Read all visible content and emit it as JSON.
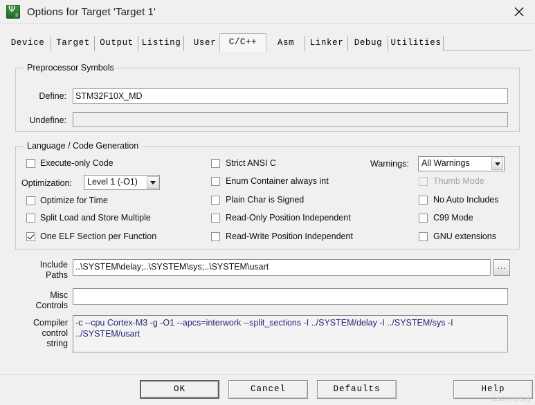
{
  "window": {
    "title": "Options for Target 'Target 1'",
    "icon": "keil-uvision-icon",
    "close_label": "✕"
  },
  "tabs": [
    {
      "label": "Device",
      "active": false
    },
    {
      "label": "Target",
      "active": false
    },
    {
      "label": "Output",
      "active": false
    },
    {
      "label": "Listing",
      "active": false
    },
    {
      "label": "User",
      "active": false
    },
    {
      "label": "C/C++",
      "active": true
    },
    {
      "label": "Asm",
      "active": false
    },
    {
      "label": "Linker",
      "active": false
    },
    {
      "label": "Debug",
      "active": false
    },
    {
      "label": "Utilities",
      "active": false
    }
  ],
  "preprocessor": {
    "legend": "Preprocessor Symbols",
    "define_label": "Define:",
    "define_value": "STM32F10X_MD",
    "undefine_label": "Undefine:",
    "undefine_value": ""
  },
  "language": {
    "legend": "Language / Code Generation",
    "col1": [
      {
        "name": "execute-only-code",
        "label": "Execute-only Code",
        "checked": false,
        "enabled": true
      },
      {
        "name": "optimize-for-time",
        "label": "Optimize for Time",
        "checked": false,
        "enabled": true
      },
      {
        "name": "split-load-and-store-multiple",
        "label": "Split Load and Store Multiple",
        "checked": false,
        "enabled": true
      },
      {
        "name": "one-elf-section-per-function",
        "label": "One ELF Section per Function",
        "checked": true,
        "enabled": true
      }
    ],
    "col2": [
      {
        "name": "strict-ansi-c",
        "label": "Strict ANSI C",
        "checked": false,
        "enabled": true
      },
      {
        "name": "enum-container-always-int",
        "label": "Enum Container always int",
        "checked": false,
        "enabled": true
      },
      {
        "name": "plain-char-is-signed",
        "label": "Plain Char is Signed",
        "checked": false,
        "enabled": true
      },
      {
        "name": "read-only-position-independent",
        "label": "Read-Only Position Independent",
        "checked": false,
        "enabled": true
      },
      {
        "name": "read-write-position-independent",
        "label": "Read-Write Position Independent",
        "checked": false,
        "enabled": true
      }
    ],
    "col3": [
      {
        "name": "thumb-mode",
        "label": "Thumb Mode",
        "checked": false,
        "enabled": false
      },
      {
        "name": "no-auto-includes",
        "label": "No Auto Includes",
        "checked": false,
        "enabled": true
      },
      {
        "name": "c99-mode",
        "label": "C99 Mode",
        "checked": false,
        "enabled": true
      },
      {
        "name": "gnu-extensions",
        "label": "GNU extensions",
        "checked": false,
        "enabled": true
      }
    ],
    "optimization_label": "Optimization:",
    "optimization_value": "Level 1 (-O1)",
    "warnings_label": "Warnings:",
    "warnings_value": "All Warnings"
  },
  "paths": {
    "include_label_line1": "Include",
    "include_label_line2": "Paths",
    "include_value": "..\\SYSTEM\\delay;..\\SYSTEM\\sys;..\\SYSTEM\\usart",
    "browse_label": "...",
    "misc_label_line1": "Misc",
    "misc_label_line2": "Controls",
    "misc_value": "",
    "compiler_label_line1": "Compiler",
    "compiler_label_line2": "control",
    "compiler_label_line3": "string",
    "compiler_value": "-c --cpu Cortex-M3 -g -O1 --apcs=interwork --split_sections -I ../SYSTEM/delay -I ../SYSTEM/sys -I ../SYSTEM/usart"
  },
  "buttons": [
    {
      "name": "ok-button",
      "label": "OK",
      "default": true
    },
    {
      "name": "cancel-button",
      "label": "Cancel",
      "default": false
    },
    {
      "name": "defaults-button",
      "label": "Defaults",
      "default": false
    },
    {
      "name": "help-button",
      "label": "Help",
      "default": false
    }
  ],
  "watermark": "CSDN @5¿5"
}
